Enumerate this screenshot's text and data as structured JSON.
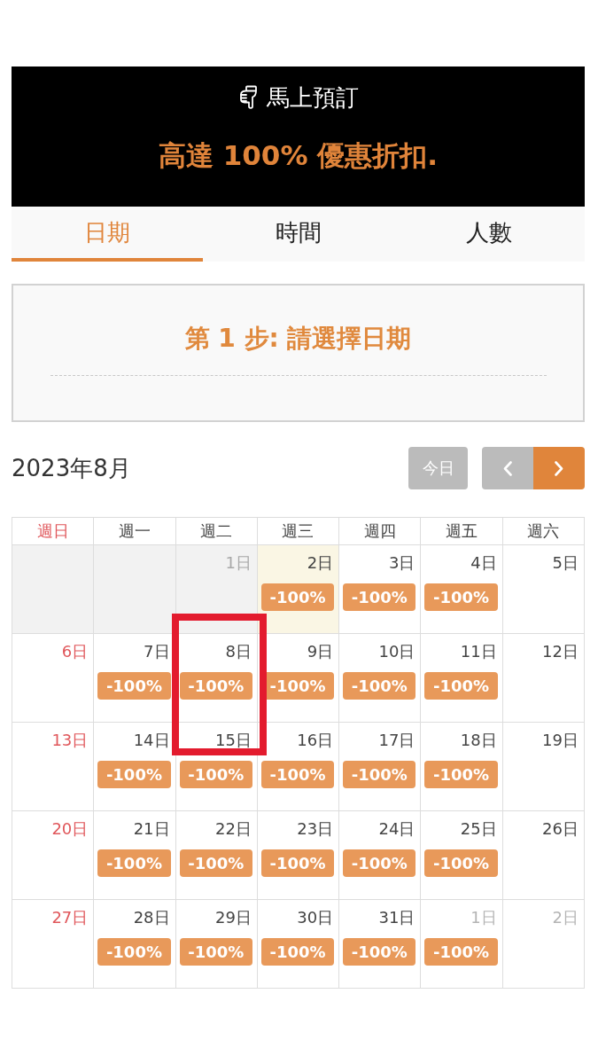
{
  "banner": {
    "title": "馬上預訂",
    "headline": "高達 100% 優惠折扣."
  },
  "tabs": [
    {
      "label": "日期",
      "selected": true
    },
    {
      "label": "時間",
      "selected": false
    },
    {
      "label": "人數",
      "selected": false
    }
  ],
  "step": {
    "title": "第 1 步: 請選擇日期"
  },
  "calendar": {
    "month": "2023年8月",
    "today_button": {
      "label": "今日",
      "disabled": true
    },
    "prev_button": {
      "disabled": true
    },
    "next_button": {
      "disabled": false
    },
    "weekdays": [
      {
        "label": "週日",
        "color": "#e0575b"
      },
      {
        "label": "週一",
        "color": "#444444"
      },
      {
        "label": "週二",
        "color": "#444444"
      },
      {
        "label": "週三",
        "color": "#444444"
      },
      {
        "label": "週四",
        "color": "#444444"
      },
      {
        "label": "週五",
        "color": "#444444"
      },
      {
        "label": "週六",
        "color": "#444444"
      }
    ],
    "weeks": [
      [
        {
          "kind": "blank",
          "marked": false
        },
        {
          "kind": "blank",
          "marked": false
        },
        {
          "kind": "past",
          "label": "1日",
          "today": false,
          "marked": false
        },
        {
          "kind": "day",
          "label": "2日",
          "today": true,
          "badge": "-100%",
          "marked": false
        },
        {
          "kind": "day",
          "label": "3日",
          "today": false,
          "badge": "-100%",
          "marked": false
        },
        {
          "kind": "day",
          "label": "4日",
          "today": false,
          "badge": "-100%",
          "marked": false
        },
        {
          "kind": "day",
          "label": "5日",
          "today": false,
          "marked": false
        }
      ],
      [
        {
          "kind": "day",
          "label": "6日",
          "today": false,
          "marked": false
        },
        {
          "kind": "day",
          "label": "7日",
          "today": false,
          "badge": "-100%",
          "marked": false
        },
        {
          "kind": "day",
          "label": "8日",
          "today": false,
          "badge": "-100%",
          "marked": true
        },
        {
          "kind": "day",
          "label": "9日",
          "today": false,
          "badge": "-100%",
          "marked": false
        },
        {
          "kind": "day",
          "label": "10日",
          "today": false,
          "badge": "-100%",
          "marked": false
        },
        {
          "kind": "day",
          "label": "11日",
          "today": false,
          "badge": "-100%",
          "marked": false
        },
        {
          "kind": "day",
          "label": "12日",
          "today": false,
          "marked": false
        }
      ],
      [
        {
          "kind": "day",
          "label": "13日",
          "today": false,
          "marked": false
        },
        {
          "kind": "day",
          "label": "14日",
          "today": false,
          "badge": "-100%",
          "marked": false
        },
        {
          "kind": "day",
          "label": "15日",
          "today": false,
          "badge": "-100%",
          "marked": false
        },
        {
          "kind": "day",
          "label": "16日",
          "today": false,
          "badge": "-100%",
          "marked": false
        },
        {
          "kind": "day",
          "label": "17日",
          "today": false,
          "badge": "-100%",
          "marked": false
        },
        {
          "kind": "day",
          "label": "18日",
          "today": false,
          "badge": "-100%",
          "marked": false
        },
        {
          "kind": "day",
          "label": "19日",
          "today": false,
          "marked": false
        }
      ],
      [
        {
          "kind": "day",
          "label": "20日",
          "today": false,
          "marked": false
        },
        {
          "kind": "day",
          "label": "21日",
          "today": false,
          "badge": "-100%",
          "marked": false
        },
        {
          "kind": "day",
          "label": "22日",
          "today": false,
          "badge": "-100%",
          "marked": false
        },
        {
          "kind": "day",
          "label": "23日",
          "today": false,
          "badge": "-100%",
          "marked": false
        },
        {
          "kind": "day",
          "label": "24日",
          "today": false,
          "badge": "-100%",
          "marked": false
        },
        {
          "kind": "day",
          "label": "25日",
          "today": false,
          "badge": "-100%",
          "marked": false
        },
        {
          "kind": "day",
          "label": "26日",
          "today": false,
          "marked": false
        }
      ],
      [
        {
          "kind": "day",
          "label": "27日",
          "today": false,
          "marked": false
        },
        {
          "kind": "day",
          "label": "28日",
          "today": false,
          "badge": "-100%",
          "marked": false
        },
        {
          "kind": "day",
          "label": "29日",
          "today": false,
          "badge": "-100%",
          "marked": false
        },
        {
          "kind": "day",
          "label": "30日",
          "today": false,
          "badge": "-100%",
          "marked": false
        },
        {
          "kind": "day",
          "label": "31日",
          "today": false,
          "badge": "-100%",
          "marked": false
        },
        {
          "kind": "next_month",
          "label": "1日",
          "today": false,
          "badge": "-100%",
          "marked": false
        },
        {
          "kind": "next_month",
          "label": "2日",
          "today": false,
          "marked": false
        }
      ]
    ]
  }
}
